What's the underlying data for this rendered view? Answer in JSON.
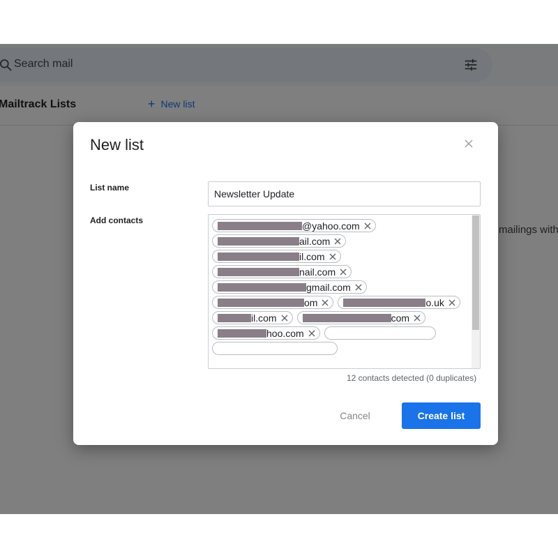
{
  "search": {
    "placeholder": "Search mail",
    "icon": "search-icon",
    "filter_icon": "tune-icon"
  },
  "list_bar": {
    "title": "Mailtrack Lists",
    "new_list_label": "New list"
  },
  "background": {
    "partial_text": "mailings with"
  },
  "modal": {
    "title": "New list",
    "list_name_label": "List name",
    "list_name_value": "Newsletter Update",
    "add_contacts_label": "Add contacts",
    "contacts": [
      {
        "visible_text": "@yahoo.com"
      },
      {
        "visible_text": "ail.com"
      },
      {
        "visible_text": "il.com"
      },
      {
        "visible_text": "nail.com"
      },
      {
        "visible_text": "gmail.com"
      },
      {
        "visible_text": "om"
      },
      {
        "visible_text": "o.uk"
      },
      {
        "visible_text": "il.com"
      },
      {
        "visible_text": "com"
      },
      {
        "visible_text": "hoo.com"
      }
    ],
    "detected_text": "12 contacts detected (0 duplicates)",
    "cancel_label": "Cancel",
    "create_label": "Create list"
  },
  "colors": {
    "primary": "#1a73e8",
    "overlay": "rgba(0,0,0,0.5)",
    "redaction": "#8a7f89"
  }
}
